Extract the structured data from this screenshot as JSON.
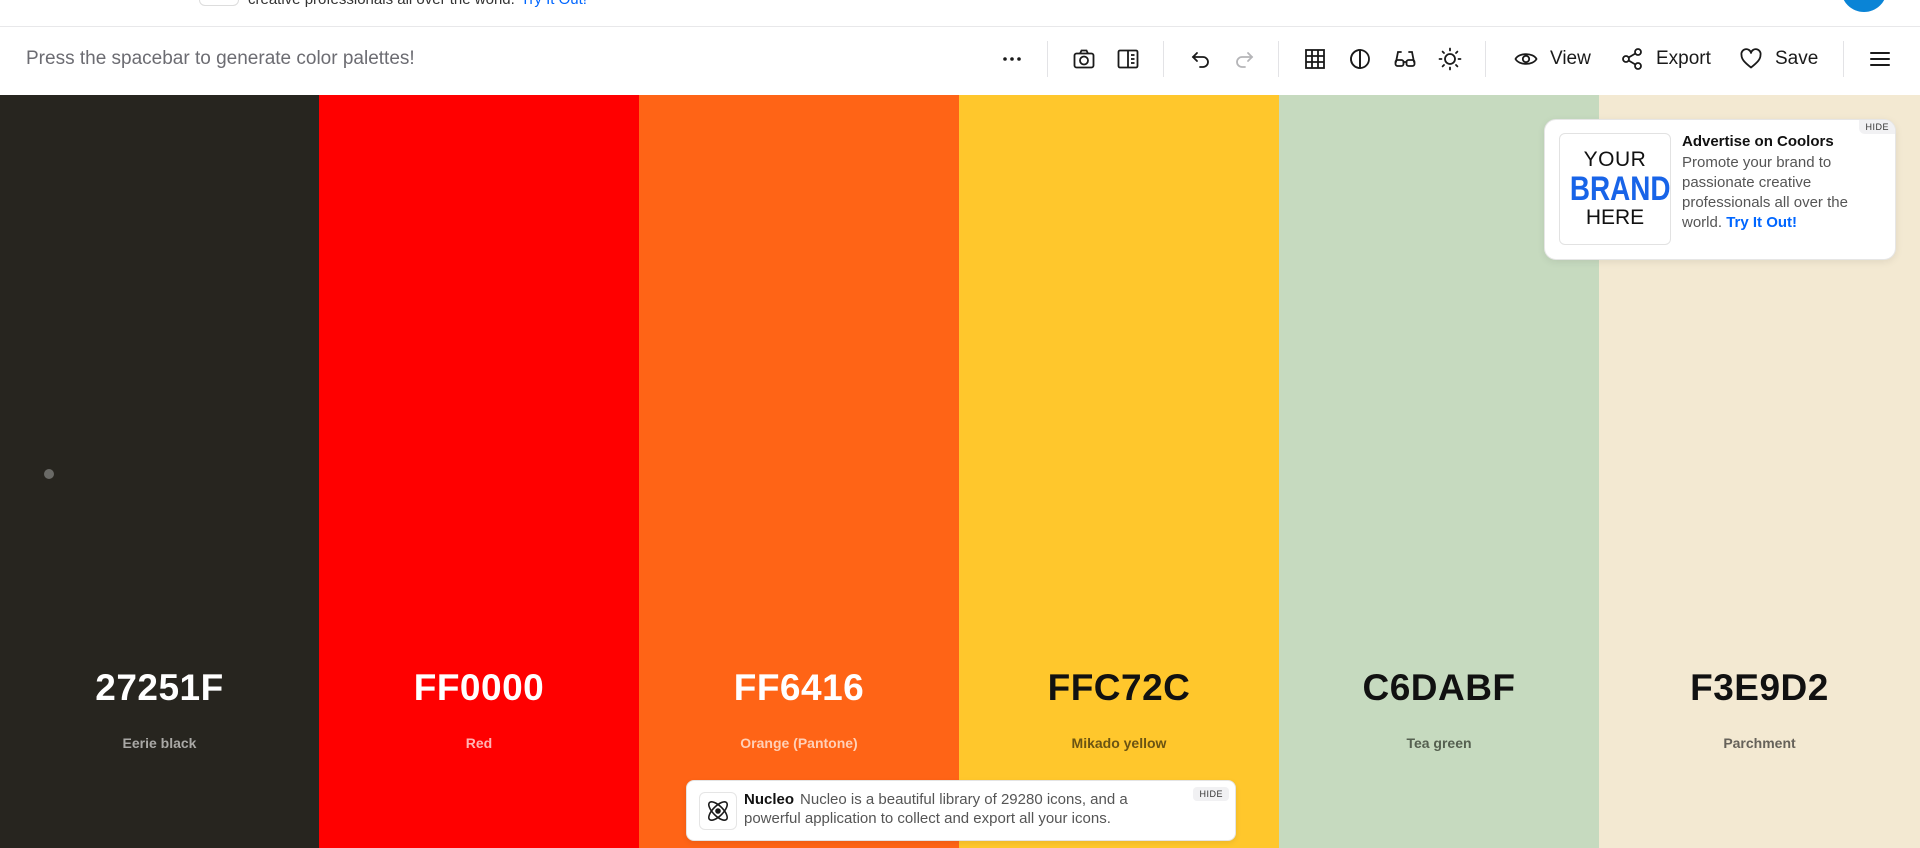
{
  "top_strip": {
    "text": "creative professionals all over the world.",
    "link": "Try It Out!"
  },
  "toolbar": {
    "hint": "Press the spacebar to generate color palettes!",
    "view_label": "View",
    "export_label": "Export",
    "save_label": "Save"
  },
  "palette": [
    {
      "hex": "27251F",
      "name": "Eerie black",
      "bg": "#27251F",
      "text_color": "#ffffff",
      "name_color": "#a9a8a5"
    },
    {
      "hex": "FF0000",
      "name": "Red",
      "bg": "#FF0000",
      "text_color": "#ffffff",
      "name_color": "#ffb3b3"
    },
    {
      "hex": "FF6416",
      "name": "Orange (Pantone)",
      "bg": "#FF6416",
      "text_color": "#ffffff",
      "name_color": "#ffd0b7"
    },
    {
      "hex": "FFC72C",
      "name": "Mikado yellow",
      "bg": "#FFC72C",
      "text_color": "#111111",
      "name_color": "#6b5413"
    },
    {
      "hex": "C6DABF",
      "name": "Tea green",
      "bg": "#C6DABF",
      "text_color": "#111111",
      "name_color": "#556050"
    },
    {
      "hex": "F3E9D2",
      "name": "Parchment",
      "bg": "#F3E9D2",
      "text_color": "#111111",
      "name_color": "#66625a"
    }
  ],
  "ad": {
    "brand_line1": "YOUR",
    "brand_line2": "BRAND",
    "brand_line3": "HERE",
    "title": "Advertise on Coolors",
    "body": "Promote your brand to passionate creative professionals all over the world.",
    "link": "Try It Out!",
    "hide": "HIDE"
  },
  "nucleo": {
    "name": "Nucleo",
    "body": "Nucleo is a beautiful library of 29280 icons, and a powerful application to collect and export all your icons.",
    "hide": "HIDE"
  }
}
